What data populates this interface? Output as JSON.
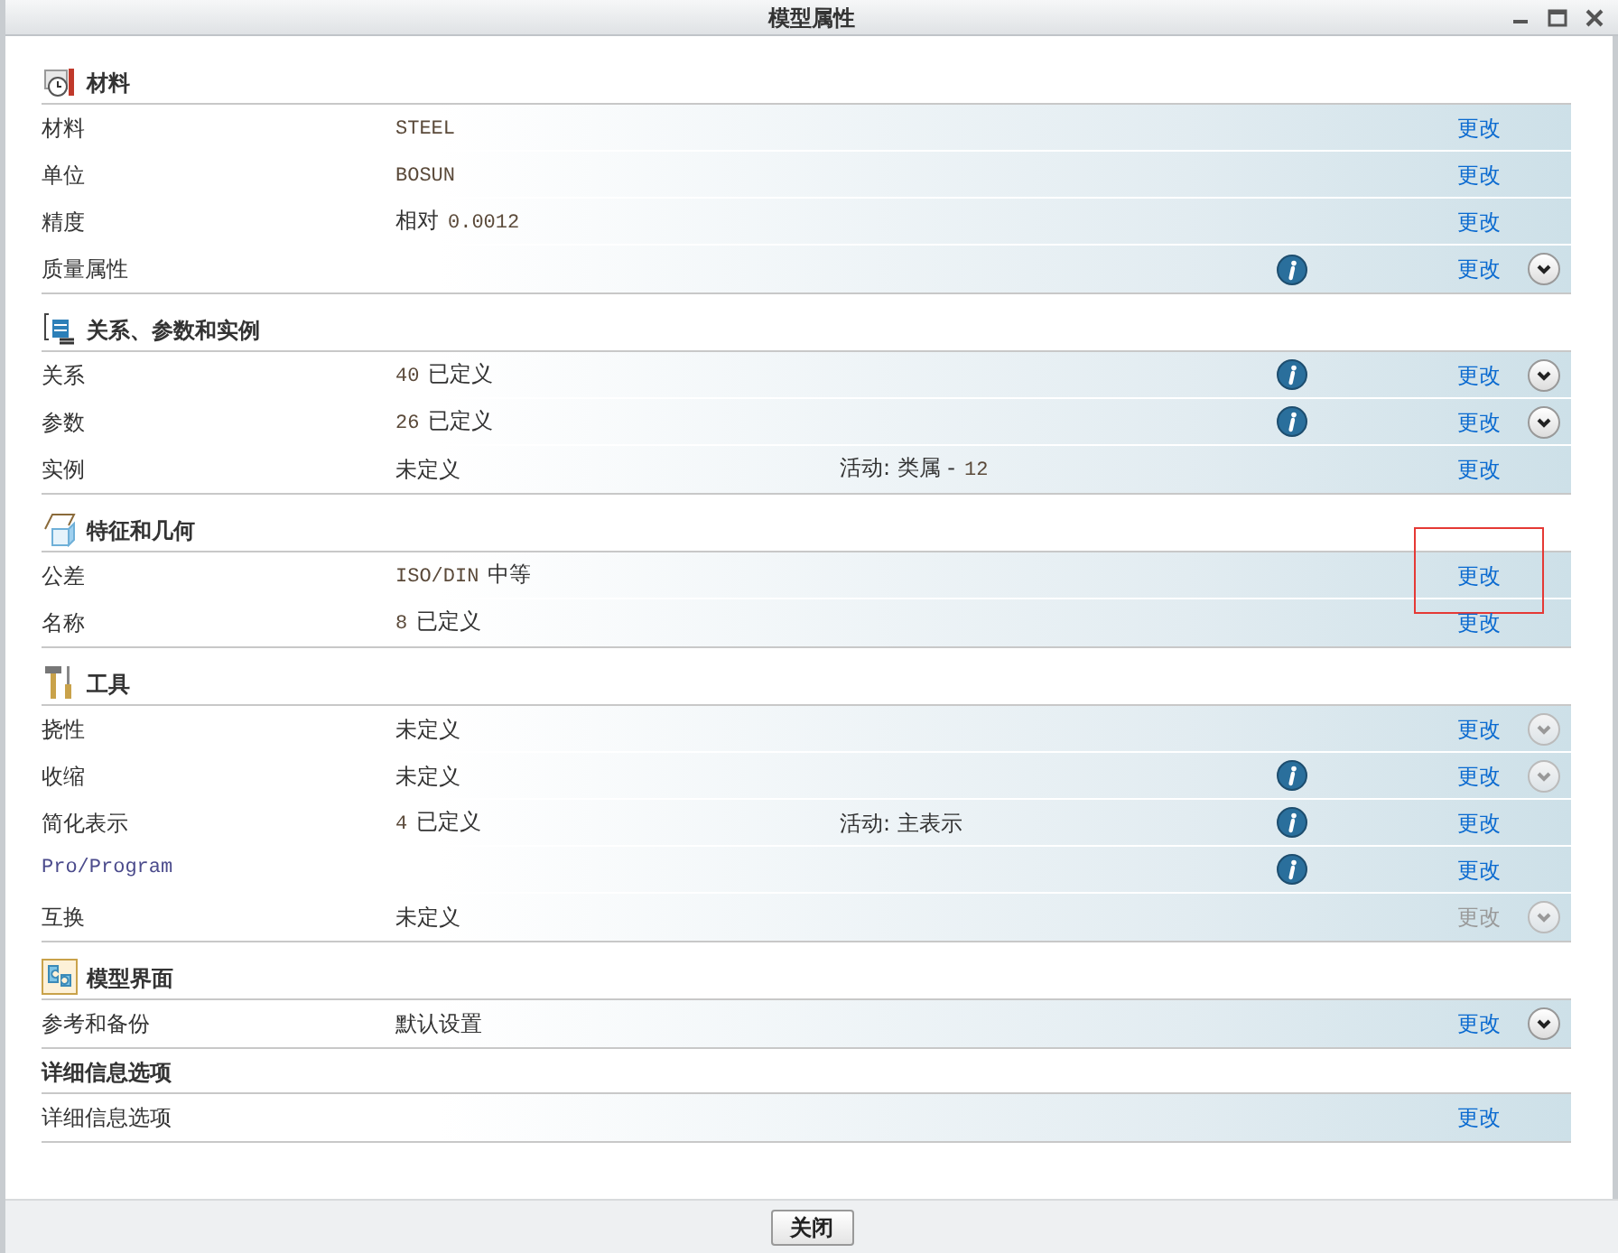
{
  "window": {
    "title": "模型属性"
  },
  "sections": [
    {
      "title": "材料",
      "rows": [
        {
          "label": "材料",
          "value": [
            {
              "text": "STEEL",
              "kind": "code"
            }
          ],
          "note": [],
          "info": false,
          "change": "更改",
          "change_disabled": false,
          "highlighted": false
        },
        {
          "label": "单位",
          "value": [
            {
              "text": "BOSUN",
              "kind": "code"
            }
          ],
          "note": [],
          "info": false,
          "change": "更改",
          "change_disabled": false,
          "highlighted": false
        },
        {
          "label": "精度",
          "value": [
            {
              "text": "相对",
              "kind": "text"
            },
            {
              "text": "0.0012",
              "kind": "code"
            }
          ],
          "note": [],
          "info": false,
          "change": "更改",
          "change_disabled": false,
          "highlighted": false
        },
        {
          "label": "质量属性",
          "value": [],
          "note": [],
          "info": true,
          "change": "更改",
          "change_disabled": false,
          "expand": {
            "disabled": false
          },
          "highlighted": false
        }
      ]
    },
    {
      "title": "关系、参数和实例",
      "rows": [
        {
          "label": "关系",
          "value": [
            {
              "text": "40",
              "kind": "code"
            },
            {
              "text": "已定义",
              "kind": "text"
            }
          ],
          "note": [],
          "info": true,
          "change": "更改",
          "change_disabled": false,
          "expand": {
            "disabled": false
          },
          "highlighted": false
        },
        {
          "label": "参数",
          "value": [
            {
              "text": "26",
              "kind": "code"
            },
            {
              "text": "已定义",
              "kind": "text"
            }
          ],
          "note": [],
          "info": true,
          "change": "更改",
          "change_disabled": false,
          "expand": {
            "disabled": false
          },
          "highlighted": false
        },
        {
          "label": "实例",
          "value": [
            {
              "text": "未定义",
              "kind": "text"
            }
          ],
          "note": [
            {
              "text": "活动: 类属 -",
              "kind": "text"
            },
            {
              "text": "12",
              "kind": "code"
            }
          ],
          "info": false,
          "change": "更改",
          "change_disabled": false,
          "highlighted": false
        }
      ]
    },
    {
      "title": "特征和几何",
      "rows": [
        {
          "label": "公差",
          "value": [
            {
              "text": "ISO/DIN",
              "kind": "code"
            },
            {
              "text": "中等",
              "kind": "text"
            }
          ],
          "note": [],
          "info": false,
          "change": "更改",
          "change_disabled": false,
          "highlighted": true
        },
        {
          "label": "名称",
          "value": [
            {
              "text": "8",
              "kind": "code"
            },
            {
              "text": "已定义",
              "kind": "text"
            }
          ],
          "note": [],
          "info": false,
          "change": "更改",
          "change_disabled": false,
          "highlighted": false
        }
      ]
    },
    {
      "title": "工具",
      "rows": [
        {
          "label": "挠性",
          "value": [
            {
              "text": "未定义",
              "kind": "text"
            }
          ],
          "note": [],
          "info": false,
          "change": "更改",
          "change_disabled": false,
          "expand": {
            "disabled": true
          },
          "highlighted": false
        },
        {
          "label": "收缩",
          "value": [
            {
              "text": "未定义",
              "kind": "text"
            }
          ],
          "note": [],
          "info": true,
          "change": "更改",
          "change_disabled": false,
          "expand": {
            "disabled": true
          },
          "highlighted": false
        },
        {
          "label": "简化表示",
          "value": [
            {
              "text": "4",
              "kind": "code"
            },
            {
              "text": "已定义",
              "kind": "text"
            }
          ],
          "note": [
            {
              "text": "活动: 主表示",
              "kind": "text"
            }
          ],
          "info": true,
          "change": "更改",
          "change_disabled": false,
          "highlighted": false
        },
        {
          "label": "Pro/Program",
          "label_code": true,
          "value": [],
          "note": [],
          "info": true,
          "change": "更改",
          "change_disabled": false,
          "highlighted": false
        },
        {
          "label": "互换",
          "value": [
            {
              "text": "未定义",
              "kind": "text"
            }
          ],
          "note": [],
          "info": false,
          "change": "更改",
          "change_disabled": true,
          "expand": {
            "disabled": true
          },
          "highlighted": false
        }
      ]
    },
    {
      "title": "模型界面",
      "rows": [
        {
          "label": "参考和备份",
          "value": [
            {
              "text": "默认设置",
              "kind": "text"
            }
          ],
          "note": [],
          "info": false,
          "change": "更改",
          "change_disabled": false,
          "expand": {
            "disabled": false
          },
          "highlighted": false
        }
      ]
    },
    {
      "title": "详细信息选项",
      "rows": [
        {
          "label": "详细信息选项",
          "value": [],
          "note": [],
          "info": false,
          "change": "更改",
          "change_disabled": false,
          "highlighted": false
        }
      ]
    }
  ],
  "footer": {
    "button": "关闭"
  }
}
